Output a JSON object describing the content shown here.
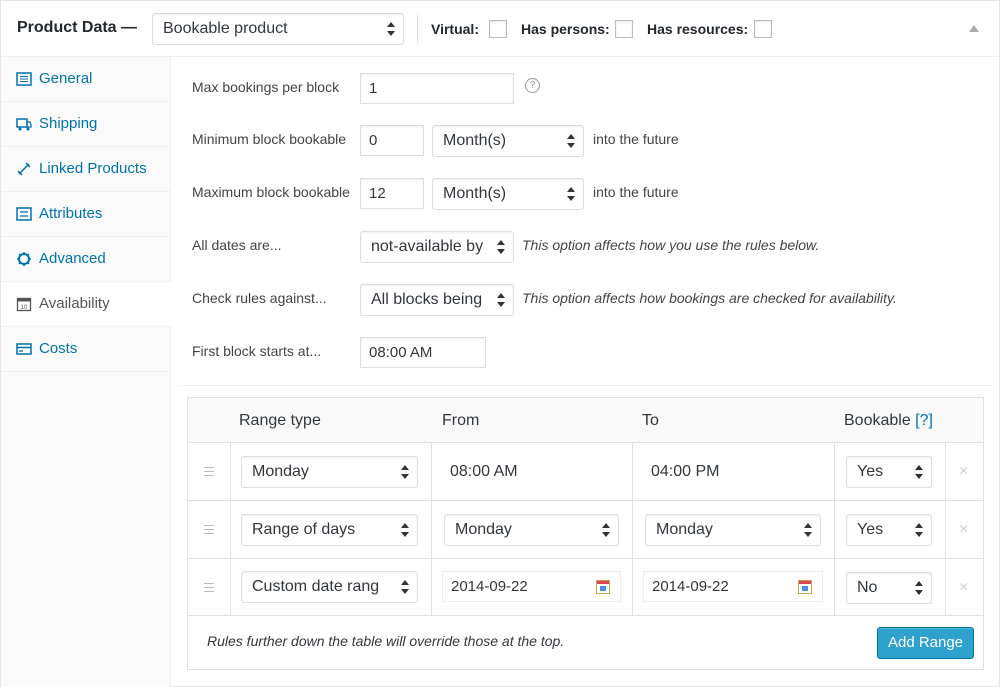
{
  "header": {
    "title": "Product Data —",
    "product_type": "Bookable product",
    "virtual_label": "Virtual:",
    "has_persons_label": "Has persons:",
    "has_resources_label": "Has resources:"
  },
  "sidebar": {
    "items": [
      {
        "label": "General",
        "icon": "general-icon",
        "active": false
      },
      {
        "label": "Shipping",
        "icon": "truck-icon",
        "active": false
      },
      {
        "label": "Linked Products",
        "icon": "link-icon",
        "active": false
      },
      {
        "label": "Attributes",
        "icon": "list-icon",
        "active": false
      },
      {
        "label": "Advanced",
        "icon": "gear-icon",
        "active": false
      },
      {
        "label": "Availability",
        "icon": "calendar-icon",
        "active": true
      },
      {
        "label": "Costs",
        "icon": "money-icon",
        "active": false
      }
    ]
  },
  "form": {
    "max_bookings_label": "Max bookings per block",
    "max_bookings_value": "1",
    "help_glyph": "?",
    "min_block_label": "Minimum block bookable",
    "min_block_value": "0",
    "min_block_unit": "Month(s)",
    "min_block_after": "into the future",
    "max_block_label": "Maximum block bookable",
    "max_block_value": "12",
    "max_block_unit": "Month(s)",
    "max_block_after": "into the future",
    "all_dates_label": "All dates are...",
    "all_dates_value": "not-available by",
    "all_dates_desc": "This option affects how you use the rules below.",
    "check_rules_label": "Check rules against...",
    "check_rules_value": "All blocks being",
    "check_rules_desc": "This option affects how bookings are checked for availability.",
    "first_block_label": "First block starts at...",
    "first_block_value": "08:00  AM"
  },
  "range_table": {
    "headers": {
      "range_type": "Range type",
      "from": "From",
      "to": "To",
      "bookable": "Bookable",
      "bookable_help": "[?]"
    },
    "rows": [
      {
        "range_type": "Monday",
        "from": "08:00  AM",
        "to": "04:00  PM",
        "bookable": "Yes"
      },
      {
        "range_type": "Range of days",
        "from": "Monday",
        "to": "Monday",
        "bookable": "Yes"
      },
      {
        "range_type": "Custom date rang",
        "from": "2014-09-22",
        "to": "2014-09-22",
        "bookable": "No"
      }
    ],
    "remove_glyph": "×",
    "footer_note": "Rules further down the table will override those at the top.",
    "add_button": "Add Range"
  },
  "colors": {
    "link": "#0073aa",
    "button": "#2ea2cc"
  }
}
